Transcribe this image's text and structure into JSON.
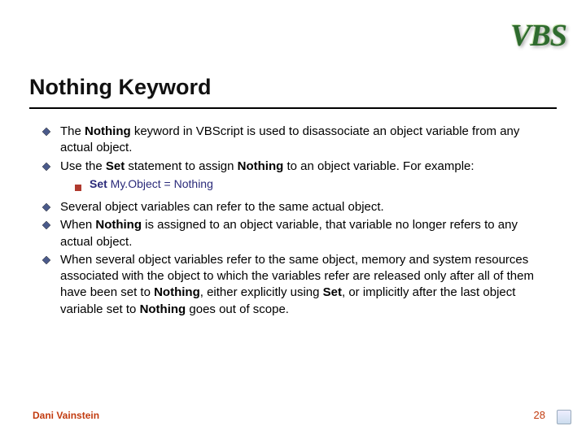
{
  "logo": "VBS",
  "title": "Nothing Keyword",
  "bullets": [
    {
      "html": "The <b>Nothing</b> keyword in VBScript is used to disassociate an object variable from any actual object."
    },
    {
      "html": "Use the <b>Set</b> statement to assign <b>Nothing</b> to an object variable. For example:",
      "sub": [
        {
          "html": "<b>Set</b> My.Object = Nothing"
        }
      ]
    },
    {
      "html": "Several object variables can refer to the same actual object."
    },
    {
      "html": "When <b>Nothing</b> is assigned to an object variable, that variable no longer refers to any actual object."
    },
    {
      "html": "When several object variables refer to the same object, memory and system resources associated with the object to which the variables refer are released only after all of them have been set to <b>Nothing</b>, either explicitly using <b>Set</b>, or implicitly after the last object variable set to <b>Nothing</b> goes out of scope."
    }
  ],
  "footer": {
    "author": "Dani Vainstein",
    "page": "28"
  }
}
